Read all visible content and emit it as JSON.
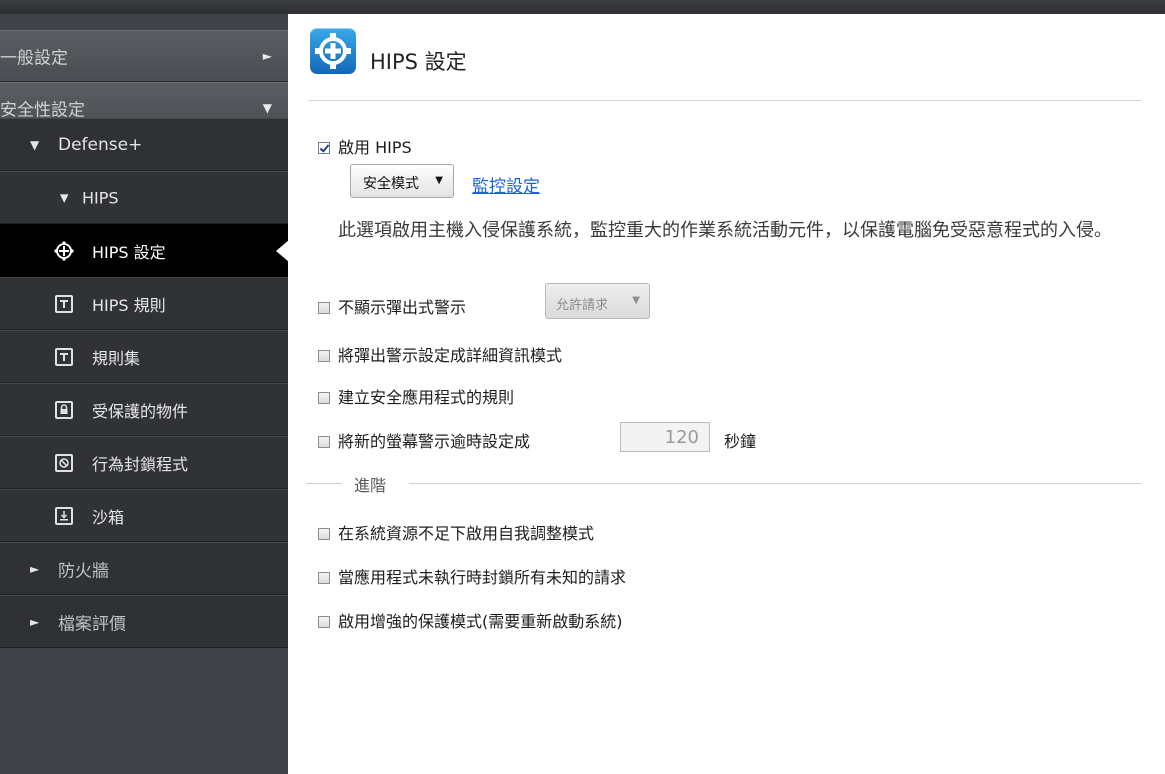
{
  "sidebar": {
    "categories": [
      {
        "label": "一般設定",
        "arrow": "►"
      },
      {
        "label": "安全性設定",
        "arrow": "▼"
      }
    ],
    "defense": {
      "label": "Defense+",
      "arrow": "▼"
    },
    "hips": {
      "label": "HIPS",
      "arrow": "▼"
    },
    "items": [
      {
        "label": "HIPS 設定",
        "icon": "hips-settings-icon"
      },
      {
        "label": "HIPS 規則",
        "icon": "hips-rules-icon"
      },
      {
        "label": "規則集",
        "icon": "ruleset-icon"
      },
      {
        "label": "受保護的物件",
        "icon": "lock-icon"
      },
      {
        "label": "行為封鎖程式",
        "icon": "block-icon"
      },
      {
        "label": "沙箱",
        "icon": "sandbox-icon"
      }
    ],
    "firewall": {
      "label": "防火牆",
      "arrow": "►"
    },
    "file_rating": {
      "label": "檔案評價",
      "arrow": "►"
    }
  },
  "main": {
    "title": "HIPS 設定",
    "enable_hips": {
      "label": "啟用 HIPS",
      "checked": true
    },
    "mode_select": {
      "value": "安全模式"
    },
    "monitor_link": "監控設定",
    "description": "此選項啟用主機入侵保護系統，監控重大的作業系統活動元件，以保護電腦免受惡意程式的入侵。",
    "no_popup": {
      "label": "不顯示彈出式警示",
      "checked": false,
      "select_value": "允許請求"
    },
    "verbose_alert": {
      "label": "將彈出警示設定成詳細資訊模式",
      "checked": false
    },
    "safe_rules": {
      "label": "建立安全應用程式的規則",
      "checked": false
    },
    "timeout": {
      "label": "將新的螢幕警示逾時設定成",
      "checked": false,
      "value": "120",
      "unit": "秒鐘"
    },
    "advanced_label": "進階",
    "adaptive_mode": {
      "label": "在系統資源不足下啟用自我調整模式",
      "checked": false
    },
    "block_unknown": {
      "label": "當應用程式未執行時封鎖所有未知的請求",
      "checked": false
    },
    "enhanced_mode": {
      "label": "啟用增強的保護模式(需要重新啟動系統)",
      "checked": false
    }
  },
  "colors": {
    "sidebar_bg": "#404347",
    "active_item_bg": "#000000",
    "link": "#1a62d6",
    "header_icon": "#1e7fd0"
  }
}
